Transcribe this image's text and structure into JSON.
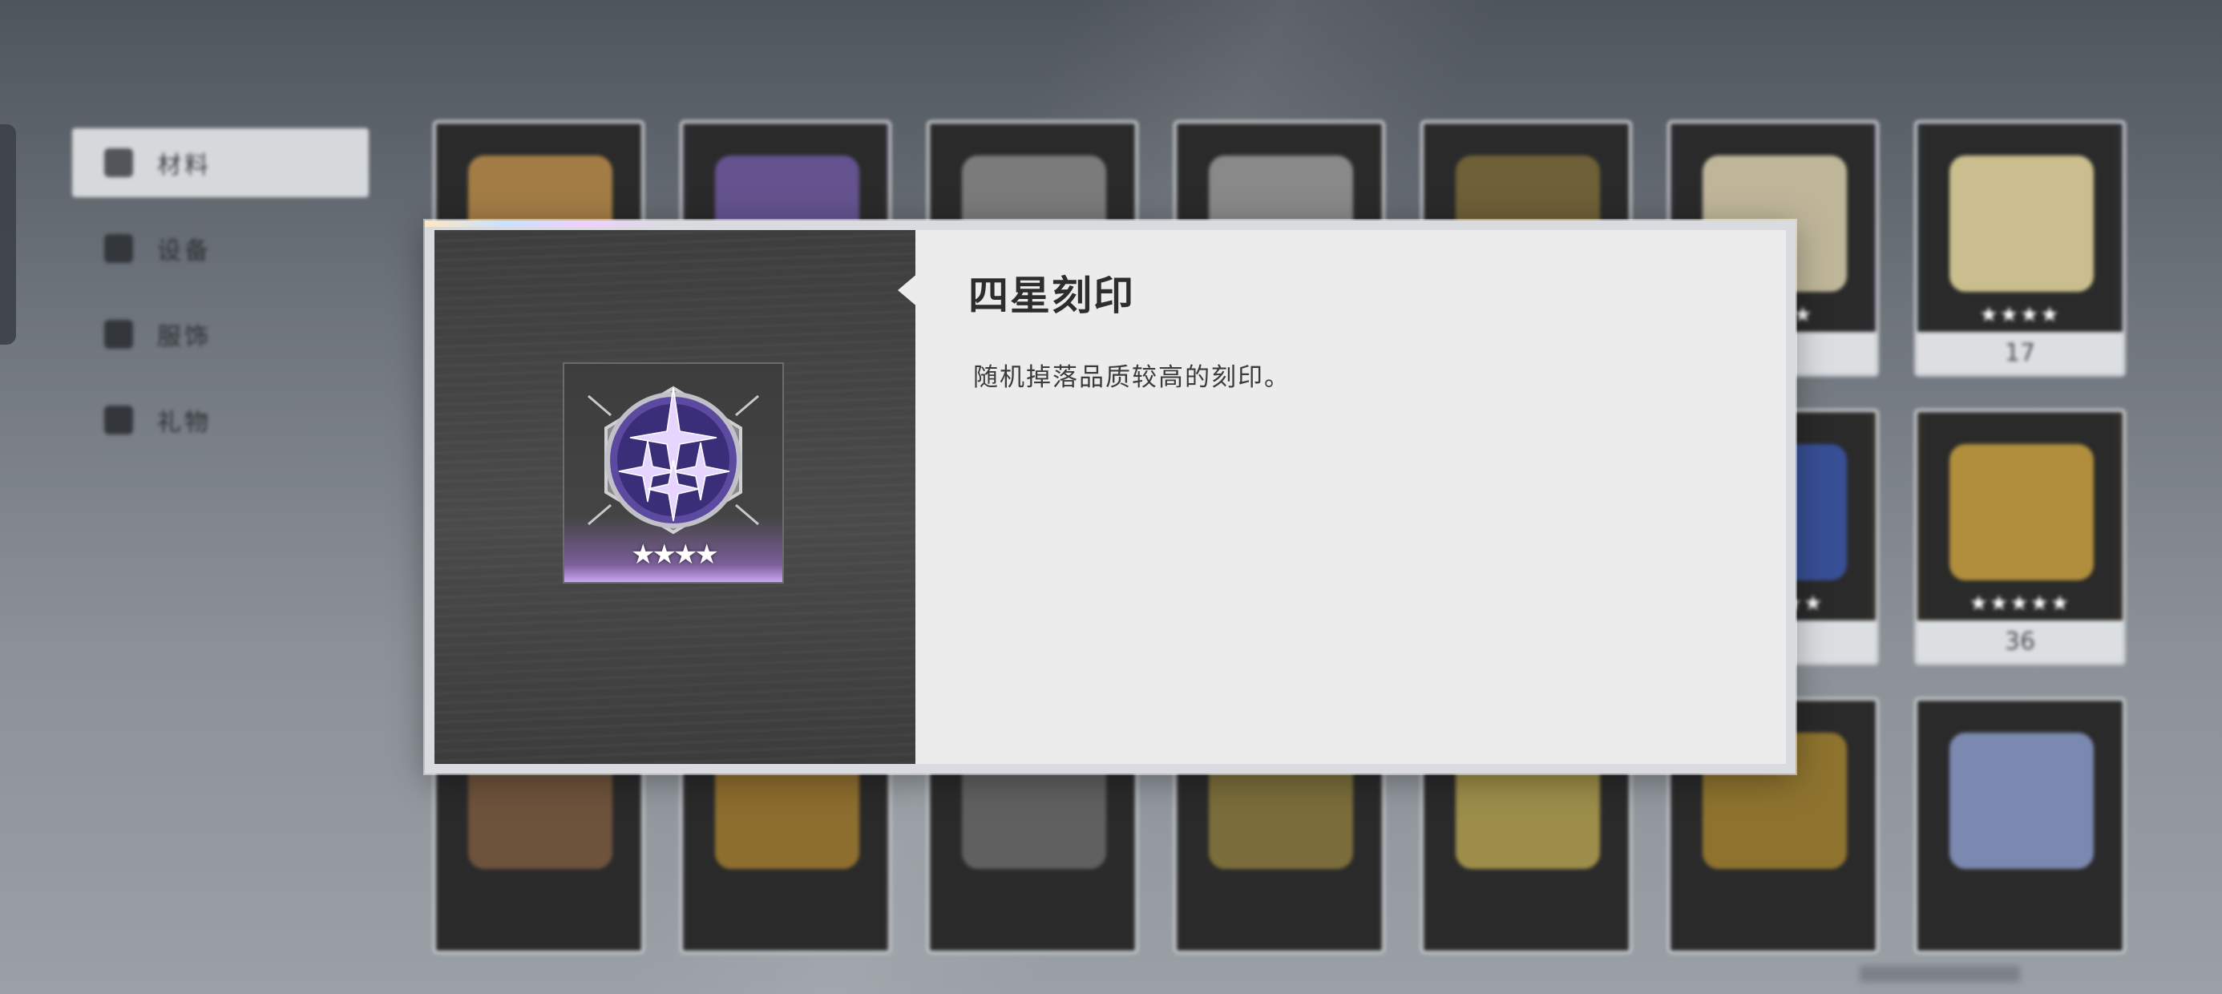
{
  "sidebar": {
    "items": [
      {
        "label": "材料",
        "icon": "materials-icon",
        "active": true
      },
      {
        "label": "设备",
        "icon": "equipment-icon",
        "active": false
      },
      {
        "label": "服饰",
        "icon": "outfit-icon",
        "active": false
      },
      {
        "label": "礼物",
        "icon": "gift-icon",
        "active": false
      }
    ]
  },
  "inventory": {
    "items": [
      {
        "count": "",
        "rarity": "none",
        "art": "#b88c4a"
      },
      {
        "count": "",
        "rarity": "purple",
        "art": "#6e5aa0"
      },
      {
        "count": "",
        "rarity": "none",
        "art": "#8a8a8a"
      },
      {
        "count": "",
        "rarity": "none",
        "art": "#9a9a9a"
      },
      {
        "count": "",
        "rarity": "none",
        "art": "#7a6a3a"
      },
      {
        "count": "",
        "rarity": "purple",
        "art": "#d9cfae",
        "stars": "★★★★"
      },
      {
        "count": "17",
        "rarity": "blue",
        "art": "#e8d8a0",
        "stars": "★★★★"
      },
      {
        "count": "",
        "rarity": "none",
        "art": "#3a3a3a"
      },
      {
        "count": "",
        "rarity": "none",
        "art": "#3a3a3a"
      },
      {
        "count": "",
        "rarity": "none",
        "art": "#3a3a3a"
      },
      {
        "count": "",
        "rarity": "none",
        "art": "#3a3a3a"
      },
      {
        "count": "",
        "rarity": "none",
        "art": "#3a3a3a"
      },
      {
        "count": "",
        "rarity": "gold",
        "art": "#3a56a8",
        "stars": "★★★★★"
      },
      {
        "count": "36",
        "rarity": "gold",
        "art": "#c8a040",
        "stars": "★★★★★"
      },
      {
        "count": "",
        "rarity": "none",
        "art": "#7a5a40"
      },
      {
        "count": "",
        "rarity": "none",
        "art": "#a07a30"
      },
      {
        "count": "",
        "rarity": "none",
        "art": "#6a6a6a"
      },
      {
        "count": "",
        "rarity": "none",
        "art": "#8a7a40"
      },
      {
        "count": "",
        "rarity": "none",
        "art": "#b0a050"
      },
      {
        "count": "",
        "rarity": "none",
        "art": "#a08030"
      },
      {
        "count": "",
        "rarity": "none",
        "art": "#8a9ac8"
      }
    ]
  },
  "detail": {
    "title": "四星刻印",
    "description": "随机掉落品质较高的刻印。",
    "stars": "★★★★",
    "icon": "four-star-imprint-icon",
    "accent": "#b58cf0"
  }
}
